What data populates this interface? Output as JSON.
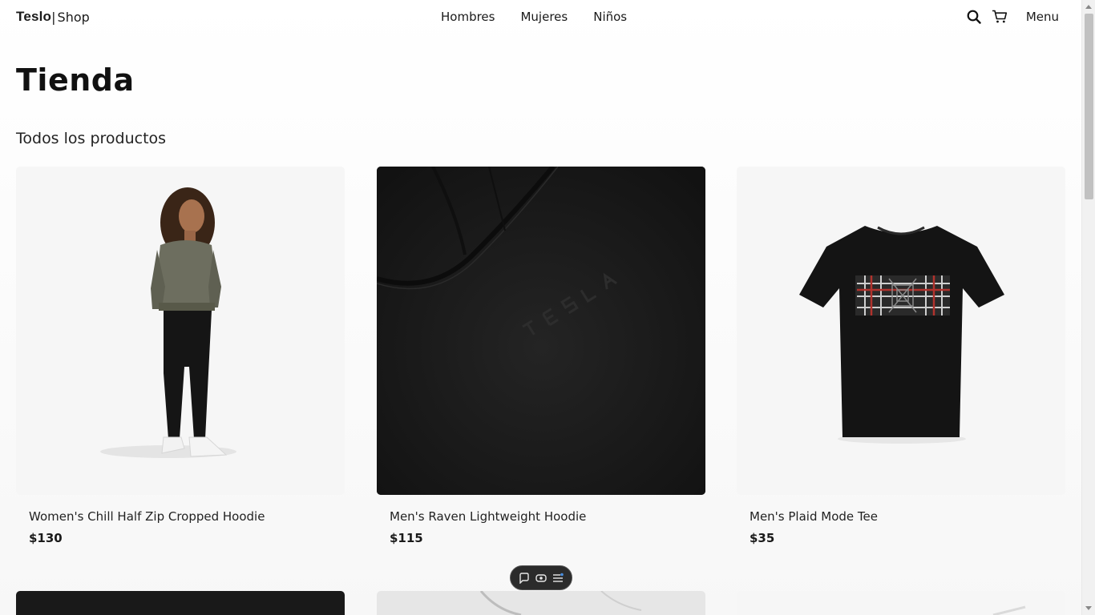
{
  "navbar": {
    "brand_name": "Teslo",
    "brand_sep": "|",
    "brand_shop": "Shop",
    "links": [
      {
        "label": "Hombres"
      },
      {
        "label": "Mujeres"
      },
      {
        "label": "Niños"
      }
    ],
    "search_icon": "search-icon",
    "cart_icon": "cart-icon",
    "menu_label": "Menu"
  },
  "page": {
    "title": "Tienda",
    "subtitle": "Todos los productos"
  },
  "products": [
    {
      "title": "Women's Chill Half Zip Cropped Hoodie",
      "price": "$130",
      "image": "woman-hoodie-photo"
    },
    {
      "title": "Men's Raven Lightweight Hoodie",
      "price": "$115",
      "image": "black-hoodie-closeup-photo"
    },
    {
      "title": "Men's Plaid Mode Tee",
      "price": "$35",
      "image": "black-tee-photo"
    }
  ],
  "next_row_images": [
    "dark-fabric-photo",
    "light-grey-fabric-photo",
    "white-product-photo"
  ],
  "toolbar": {
    "icons": [
      "comment-icon",
      "eye-icon",
      "list-settings-icon"
    ]
  },
  "colors": {
    "accent": "#1a1a1a",
    "card_light": "#f6f6f6",
    "card_dark": "#191919"
  }
}
